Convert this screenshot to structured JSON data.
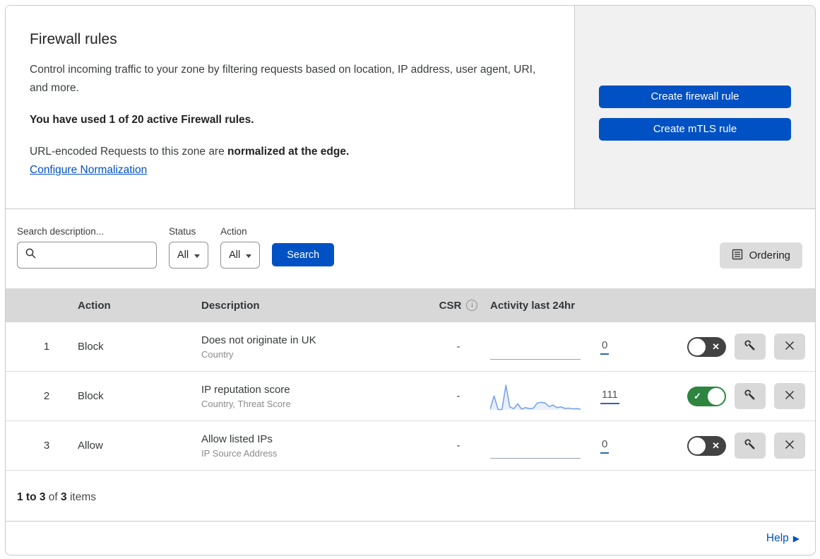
{
  "header": {
    "title": "Firewall rules",
    "description": "Control incoming traffic to your zone by filtering requests based on location, IP address, user agent, URI, and more.",
    "usage": "You have used 1 of 20 active Firewall rules.",
    "normalization_prefix": "URL-encoded Requests to this zone are ",
    "normalization_bold": "normalized at the edge.",
    "normalization_link": "Configure Normalization",
    "actions": {
      "create_firewall_rule": "Create firewall rule",
      "create_mtls_rule": "Create mTLS rule"
    }
  },
  "filters": {
    "search_label": "Search description...",
    "status_label": "Status",
    "status_value": "All",
    "action_label": "Action",
    "action_value": "All",
    "search_button": "Search",
    "ordering_button": "Ordering"
  },
  "table": {
    "columns": {
      "action": "Action",
      "description": "Description",
      "csr": "CSR",
      "activity": "Activity last 24hr"
    },
    "rows": [
      {
        "index": "1",
        "action": "Block",
        "description": "Does not originate in UK",
        "criteria": "Country",
        "csr": "-",
        "activity_count": "0",
        "enabled": false,
        "sparkline": null
      },
      {
        "index": "2",
        "action": "Block",
        "description": "IP reputation score",
        "criteria": "Country, Threat Score",
        "csr": "-",
        "activity_count": "111",
        "enabled": true,
        "sparkline": [
          3,
          55,
          2,
          1,
          97,
          12,
          5,
          24,
          3,
          9,
          5,
          7,
          27,
          30,
          27,
          13,
          19,
          9,
          12,
          6,
          7,
          4,
          5,
          3
        ]
      },
      {
        "index": "3",
        "action": "Allow",
        "description": "Allow listed IPs",
        "criteria": "IP Source Address",
        "csr": "-",
        "activity_count": "0",
        "enabled": false,
        "sparkline": null
      }
    ]
  },
  "footer": {
    "count_range": "1 to 3",
    "count_of": " of ",
    "count_total": "3",
    "count_items": " items",
    "help": "Help"
  },
  "icons": {
    "info": "i",
    "toggle_off": "✕",
    "toggle_on": "✓",
    "help_arrow": "▶"
  },
  "colors": {
    "primary_blue": "#0051c3",
    "toggle_on_green": "#2e8540",
    "toggle_off_gray": "#424242",
    "sparkline_line": "#78a4e8",
    "sparkline_fill": "#e9effb",
    "table_header_bg": "#d8d8d8"
  }
}
